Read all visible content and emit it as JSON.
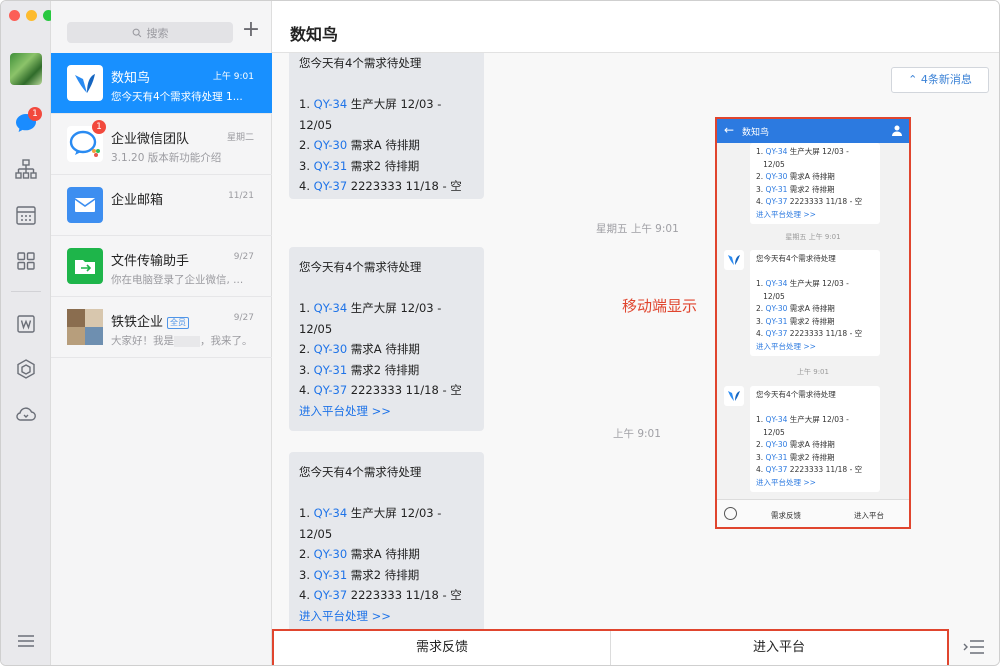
{
  "window": {
    "title": "数知鸟"
  },
  "rail": {
    "icons": [
      "avatar",
      "chat-icon",
      "org-chart-icon",
      "calendar-icon",
      "apps-grid-icon",
      "doc-w-icon",
      "hexagon-icon",
      "cloud-icon",
      "menu-icon"
    ],
    "chat_badge": "1"
  },
  "search": {
    "placeholder": "搜索"
  },
  "conversations": [
    {
      "name": "数知鸟",
      "time": "上午 9:01",
      "preview": "您今天有4个需求待处理 1...",
      "active": true
    },
    {
      "name": "企业微信团队",
      "time": "星期二",
      "preview": "3.1.20 版本新功能介绍",
      "badge": "1"
    },
    {
      "name": "企业邮箱",
      "time": "11/21",
      "preview": ""
    },
    {
      "name": "文件传输助手",
      "time": "9/27",
      "preview": "你在电脑登录了企业微信, ..."
    },
    {
      "name": "铁铁企业",
      "tag": "全员",
      "time": "9/27",
      "preview_a": "大家好！我是",
      "preview_b": "，我来了。"
    }
  ],
  "main": {
    "title": "数知鸟",
    "new_messages": "4条新消息",
    "mobile_label": "移动端显示",
    "time_separators": [
      "星期五 上午 9:01",
      "上午 9:01"
    ],
    "message": {
      "title": "您今天有4个需求待处理",
      "items": [
        {
          "num": "1.",
          "ticket": "QY-34",
          "text": "生产大屏  12/03 - 12/05"
        },
        {
          "num": "2.",
          "ticket": "QY-30",
          "text": "需求A  待排期"
        },
        {
          "num": "3.",
          "ticket": "QY-31",
          "text": "需求2  待排期"
        },
        {
          "num": "4.",
          "ticket": "QY-37",
          "text": "2223333  11/18 - 空"
        }
      ],
      "link": "进入平台处理 >>"
    },
    "top_partial_title": "您今天有4个需求待处理"
  },
  "phone": {
    "title": "数知鸟",
    "times": [
      "星期五 上午 9:01",
      "上午 9:01"
    ],
    "footer": {
      "left": "需求反馈",
      "right": "进入平台"
    },
    "card_items": [
      {
        "num": "1.",
        "ticket": "QY-34",
        "text": "生产大屏  12/03 -"
      },
      {
        "num": "",
        "ticket": "",
        "text": "12/05"
      },
      {
        "num": "2.",
        "ticket": "QY-30",
        "text": "需求A  待排期"
      },
      {
        "num": "3.",
        "ticket": "QY-31",
        "text": "需求2  待排期"
      },
      {
        "num": "4.",
        "ticket": "QY-37",
        "text": "2223333  11/18 - 空"
      }
    ]
  },
  "menubar": {
    "left": "需求反馈",
    "right": "进入平台"
  }
}
